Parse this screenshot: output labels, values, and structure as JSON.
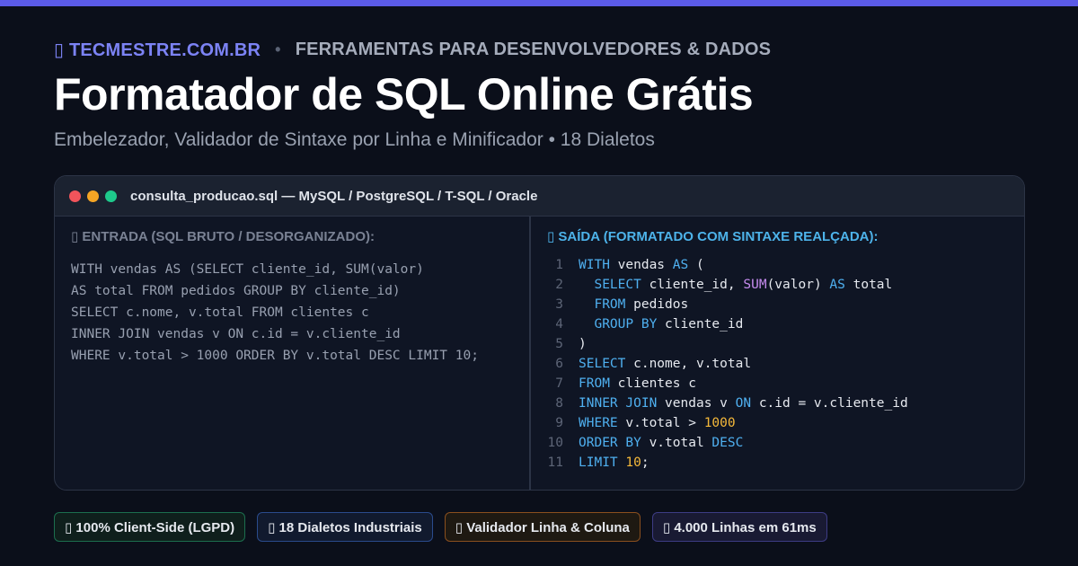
{
  "header": {
    "brand": "▯ TECMESTRE.COM.BR",
    "separator": "•",
    "section": "FERRAMENTAS PARA DESENVOLVEDORES & DADOS",
    "title": "Formatador de SQL Online Grátis",
    "subtitle": "Embelezador, Validador de Sintaxe por Linha e Minificador • 18 Dialetos"
  },
  "window": {
    "title": "consulta_producao.sql — MySQL / PostgreSQL / T-SQL / Oracle",
    "input": {
      "label": "▯ ENTRADA (SQL BRUTO / DESORGANIZADO):",
      "lines": [
        "WITH vendas AS (SELECT cliente_id, SUM(valor)",
        "AS total FROM pedidos GROUP BY cliente_id)",
        "SELECT c.nome, v.total FROM clientes c",
        "INNER JOIN vendas v ON c.id = v.cliente_id",
        "WHERE v.total > 1000 ORDER BY v.total DESC LIMIT 10;"
      ]
    },
    "output": {
      "label": "▯ SAÍDA (FORMATADO COM SINTAXE REALÇADA):",
      "lines": [
        {
          "n": "1",
          "tokens": [
            [
              "kw",
              "WITH"
            ],
            [
              "tx",
              " vendas "
            ],
            [
              "kw",
              "AS"
            ],
            [
              "tx",
              " ("
            ]
          ]
        },
        {
          "n": "2",
          "tokens": [
            [
              "tx",
              "  "
            ],
            [
              "kw",
              "SELECT"
            ],
            [
              "tx",
              " cliente_id, "
            ],
            [
              "fn",
              "SUM"
            ],
            [
              "tx",
              "(valor) "
            ],
            [
              "kw",
              "AS"
            ],
            [
              "tx",
              " total"
            ]
          ]
        },
        {
          "n": "3",
          "tokens": [
            [
              "tx",
              "  "
            ],
            [
              "kw",
              "FROM"
            ],
            [
              "tx",
              " pedidos"
            ]
          ]
        },
        {
          "n": "4",
          "tokens": [
            [
              "tx",
              "  "
            ],
            [
              "kw",
              "GROUP BY"
            ],
            [
              "tx",
              " cliente_id"
            ]
          ]
        },
        {
          "n": "5",
          "tokens": [
            [
              "tx",
              ")"
            ]
          ]
        },
        {
          "n": "6",
          "tokens": [
            [
              "kw",
              "SELECT"
            ],
            [
              "tx",
              " c.nome, v.total"
            ]
          ]
        },
        {
          "n": "7",
          "tokens": [
            [
              "kw",
              "FROM"
            ],
            [
              "tx",
              " clientes c"
            ]
          ]
        },
        {
          "n": "8",
          "tokens": [
            [
              "kw",
              "INNER JOIN"
            ],
            [
              "tx",
              " vendas v "
            ],
            [
              "kw",
              "ON"
            ],
            [
              "tx",
              " c.id = v.cliente_id"
            ]
          ]
        },
        {
          "n": "9",
          "tokens": [
            [
              "kw",
              "WHERE"
            ],
            [
              "tx",
              " v.total > "
            ],
            [
              "num",
              "1000"
            ]
          ]
        },
        {
          "n": "10",
          "tokens": [
            [
              "kw",
              "ORDER BY"
            ],
            [
              "tx",
              " v.total "
            ],
            [
              "kw",
              "DESC"
            ]
          ]
        },
        {
          "n": "11",
          "tokens": [
            [
              "kw",
              "LIMIT"
            ],
            [
              "tx",
              " "
            ],
            [
              "num",
              "10"
            ],
            [
              "tx",
              ";"
            ]
          ]
        }
      ]
    }
  },
  "badges": [
    {
      "label": "▯ 100% Client-Side (LGPD)",
      "tone": "green"
    },
    {
      "label": "▯ 18 Dialetos Industriais",
      "tone": "blue"
    },
    {
      "label": "▯ Validador Linha & Coluna",
      "tone": "orange"
    },
    {
      "label": "▯ 4.000 Linhas em 61ms",
      "tone": "purple"
    }
  ],
  "colors": {
    "accent": "#5b5be8",
    "brand": "#7c83f5",
    "keyword": "#4fb0f0",
    "function": "#c78cf0",
    "number": "#f5b93a",
    "traffic_red": "#f2545b",
    "traffic_yellow": "#f5a524",
    "traffic_green": "#1ec98b"
  }
}
